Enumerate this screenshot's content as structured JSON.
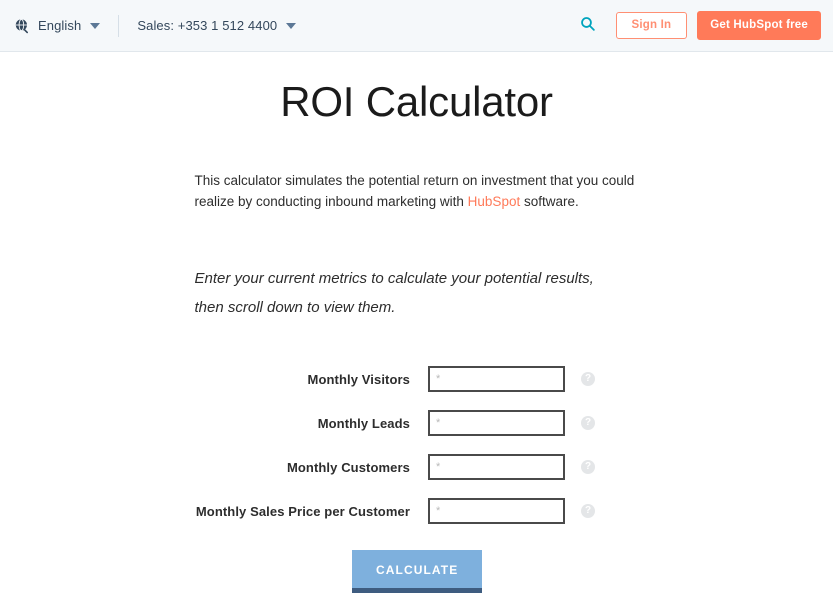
{
  "topbar": {
    "globe_icon": "globe-icon",
    "language": "English",
    "language_caret": "chevron-down-icon",
    "sales_phone": "Sales: +353 1 512 4400",
    "sales_caret": "chevron-down-icon",
    "search_icon": "search-icon",
    "sign_in_label": "Sign In",
    "cta_label": "Get HubSpot free",
    "colors": {
      "background": "#f5f8fa",
      "text": "#33475b",
      "search_icon": "#00a4bd",
      "cta_background": "#ff7a59",
      "signin_border": "#ff8f73"
    }
  },
  "page": {
    "title": "ROI Calculator",
    "intro_before_link": "This calculator simulates the potential return on investment that you could realize by conducting inbound marketing with ",
    "intro_link": "HubSpot",
    "intro_after_link": " software.",
    "instruction_line1": "Enter your current metrics to calculate your potential results,",
    "instruction_line2": "then scroll down to view them.",
    "link_color": "#ff7a59"
  },
  "form": {
    "placeholder": "*",
    "help_glyph": "?",
    "fields": [
      {
        "label": "Monthly Visitors",
        "value": "",
        "help": "help-icon"
      },
      {
        "label": "Monthly Leads",
        "value": "",
        "help": "help-icon"
      },
      {
        "label": "Monthly Customers",
        "value": "",
        "help": "help-icon"
      },
      {
        "label": "Monthly Sales Price per Customer",
        "value": "",
        "help": "help-icon"
      }
    ],
    "calculate_label": "CALCULATE",
    "calculate_color": "#7eb0dd",
    "calculate_shadow_color": "#3e5c80"
  }
}
